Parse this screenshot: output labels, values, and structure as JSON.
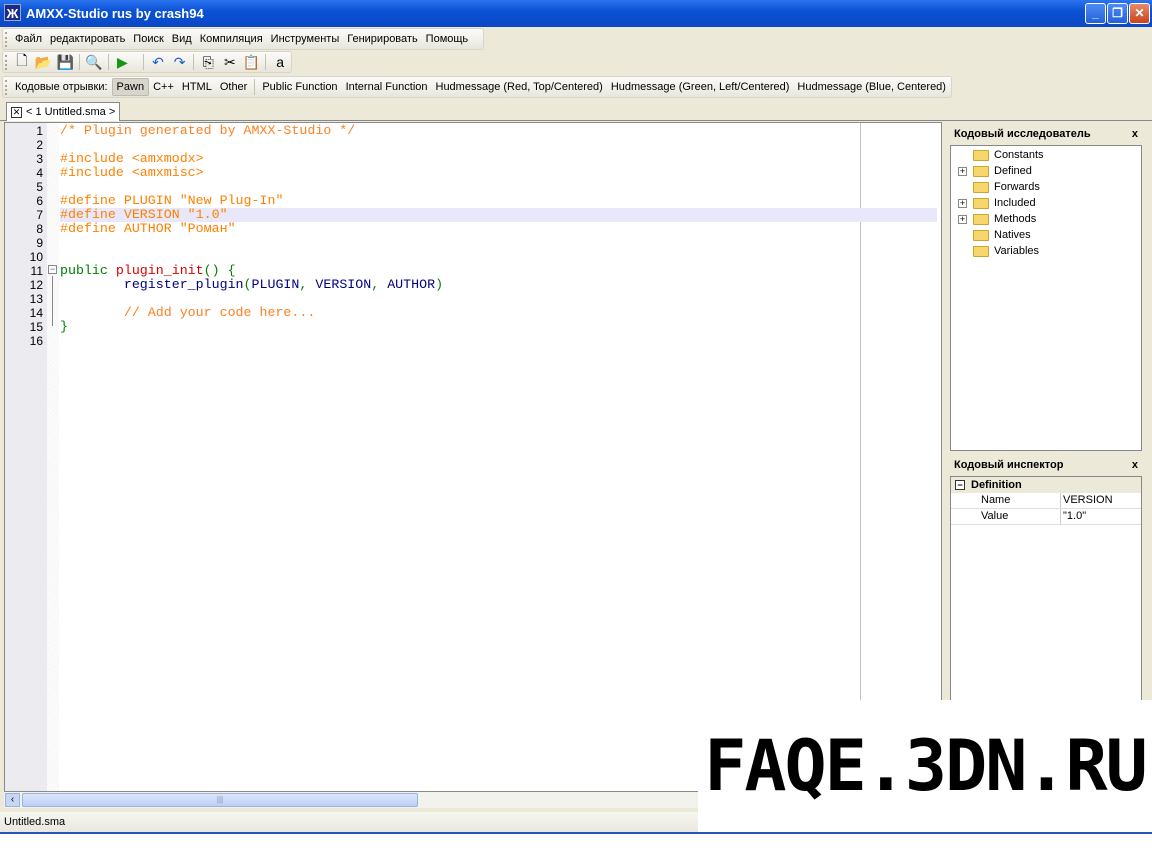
{
  "window": {
    "title": "AMXX-Studio rus by crash94",
    "icons": [
      "app-icon",
      "minimize-icon",
      "restore-icon",
      "close-icon"
    ]
  },
  "menu": [
    "Файл",
    "редактировать",
    "Поиск",
    "Вид",
    "Компиляция",
    "Инструменты",
    "Генирировать",
    "Помощь"
  ],
  "toolbar": [
    "new-file-icon",
    "open-folder-icon",
    "save-icon",
    "find-icon",
    "run-icon",
    "undo-icon",
    "redo-icon",
    "copy-icon",
    "cut-icon",
    "paste-icon",
    "select-all-icon"
  ],
  "snippets": {
    "label": "Кодовые отрывки:",
    "langs": [
      "Pawn",
      "C++",
      "HTML",
      "Other"
    ],
    "active": "Pawn",
    "items": [
      "Public Function",
      "Internal Function",
      "Hudmessage (Red, Top/Centered)",
      "Hudmessage (Green, Left/Centered)",
      "Hudmessage (Blue, Centered)"
    ]
  },
  "tab": {
    "label": "< 1 Untitled.sma >"
  },
  "editor": {
    "current_line": 7,
    "lines": [
      [
        [
          "c-cm",
          "/* Plugin generated by AMXX-Studio */"
        ]
      ],
      [],
      [
        [
          "c-pp",
          "#include <amxmodx>"
        ]
      ],
      [
        [
          "c-pp",
          "#include <amxmisc>"
        ]
      ],
      [],
      [
        [
          "c-pp",
          "#define PLUGIN \"New Plug-In\""
        ]
      ],
      [
        [
          "c-pp",
          "#define VERSION \"1.0\""
        ]
      ],
      [
        [
          "c-pp",
          "#define AUTHOR \"Роман\""
        ]
      ],
      [],
      [],
      [
        [
          "c-kw",
          "public "
        ],
        [
          "c-fn",
          "plugin_init"
        ],
        [
          "c-p",
          "() {"
        ]
      ],
      [
        [
          "c-id",
          "        register_plugin"
        ],
        [
          "c-p",
          "("
        ],
        [
          "c-id",
          "PLUGIN"
        ],
        [
          "c-p",
          ", "
        ],
        [
          "c-id",
          "VERSION"
        ],
        [
          "c-p",
          ", "
        ],
        [
          "c-id",
          "AUTHOR"
        ],
        [
          "c-p",
          ")"
        ]
      ],
      [],
      [
        [
          "c-cm",
          "        // Add your code here..."
        ]
      ],
      [
        [
          "c-p",
          "}"
        ]
      ],
      []
    ]
  },
  "explorer": {
    "title": "Кодовый исследователь",
    "close": "x",
    "nodes": [
      {
        "label": "Constants",
        "expandable": false
      },
      {
        "label": "Defined",
        "expandable": true
      },
      {
        "label": "Forwards",
        "expandable": false
      },
      {
        "label": "Included",
        "expandable": true
      },
      {
        "label": "Methods",
        "expandable": true
      },
      {
        "label": "Natives",
        "expandable": false
      },
      {
        "label": "Variables",
        "expandable": false
      }
    ]
  },
  "inspector": {
    "title": "Кодовый инспектор",
    "close": "x",
    "section": "Definition",
    "rows": [
      {
        "k": "Name",
        "v": "VERSION"
      },
      {
        "k": "Value",
        "v": "\"1.0\""
      }
    ]
  },
  "status": {
    "file": "Untitled.sma"
  },
  "watermark": "FAQE.3DN.RU"
}
